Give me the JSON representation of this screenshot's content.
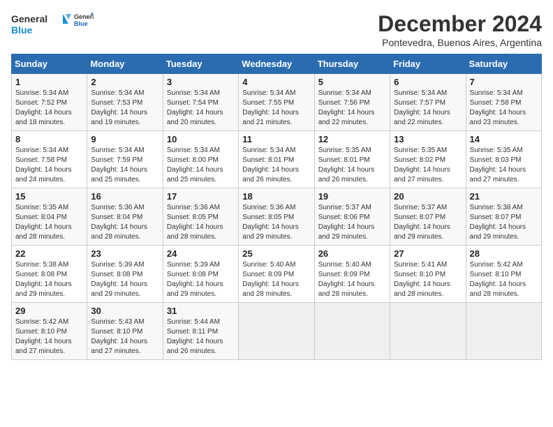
{
  "header": {
    "logo_line1": "General",
    "logo_line2": "Blue",
    "month_year": "December 2024",
    "location": "Pontevedra, Buenos Aires, Argentina"
  },
  "weekdays": [
    "Sunday",
    "Monday",
    "Tuesday",
    "Wednesday",
    "Thursday",
    "Friday",
    "Saturday"
  ],
  "weeks": [
    [
      {
        "day": "1",
        "sunrise": "5:34 AM",
        "sunset": "7:52 PM",
        "daylight": "14 hours and 18 minutes."
      },
      {
        "day": "2",
        "sunrise": "5:34 AM",
        "sunset": "7:53 PM",
        "daylight": "14 hours and 19 minutes."
      },
      {
        "day": "3",
        "sunrise": "5:34 AM",
        "sunset": "7:54 PM",
        "daylight": "14 hours and 20 minutes."
      },
      {
        "day": "4",
        "sunrise": "5:34 AM",
        "sunset": "7:55 PM",
        "daylight": "14 hours and 21 minutes."
      },
      {
        "day": "5",
        "sunrise": "5:34 AM",
        "sunset": "7:56 PM",
        "daylight": "14 hours and 22 minutes."
      },
      {
        "day": "6",
        "sunrise": "5:34 AM",
        "sunset": "7:57 PM",
        "daylight": "14 hours and 22 minutes."
      },
      {
        "day": "7",
        "sunrise": "5:34 AM",
        "sunset": "7:58 PM",
        "daylight": "14 hours and 23 minutes."
      }
    ],
    [
      {
        "day": "8",
        "sunrise": "5:34 AM",
        "sunset": "7:58 PM",
        "daylight": "14 hours and 24 minutes."
      },
      {
        "day": "9",
        "sunrise": "5:34 AM",
        "sunset": "7:59 PM",
        "daylight": "14 hours and 25 minutes."
      },
      {
        "day": "10",
        "sunrise": "5:34 AM",
        "sunset": "8:00 PM",
        "daylight": "14 hours and 25 minutes."
      },
      {
        "day": "11",
        "sunrise": "5:34 AM",
        "sunset": "8:01 PM",
        "daylight": "14 hours and 26 minutes."
      },
      {
        "day": "12",
        "sunrise": "5:35 AM",
        "sunset": "8:01 PM",
        "daylight": "14 hours and 26 minutes."
      },
      {
        "day": "13",
        "sunrise": "5:35 AM",
        "sunset": "8:02 PM",
        "daylight": "14 hours and 27 minutes."
      },
      {
        "day": "14",
        "sunrise": "5:35 AM",
        "sunset": "8:03 PM",
        "daylight": "14 hours and 27 minutes."
      }
    ],
    [
      {
        "day": "15",
        "sunrise": "5:35 AM",
        "sunset": "8:04 PM",
        "daylight": "14 hours and 28 minutes."
      },
      {
        "day": "16",
        "sunrise": "5:36 AM",
        "sunset": "8:04 PM",
        "daylight": "14 hours and 28 minutes."
      },
      {
        "day": "17",
        "sunrise": "5:36 AM",
        "sunset": "8:05 PM",
        "daylight": "14 hours and 28 minutes."
      },
      {
        "day": "18",
        "sunrise": "5:36 AM",
        "sunset": "8:05 PM",
        "daylight": "14 hours and 29 minutes."
      },
      {
        "day": "19",
        "sunrise": "5:37 AM",
        "sunset": "8:06 PM",
        "daylight": "14 hours and 29 minutes."
      },
      {
        "day": "20",
        "sunrise": "5:37 AM",
        "sunset": "8:07 PM",
        "daylight": "14 hours and 29 minutes."
      },
      {
        "day": "21",
        "sunrise": "5:38 AM",
        "sunset": "8:07 PM",
        "daylight": "14 hours and 29 minutes."
      }
    ],
    [
      {
        "day": "22",
        "sunrise": "5:38 AM",
        "sunset": "8:08 PM",
        "daylight": "14 hours and 29 minutes."
      },
      {
        "day": "23",
        "sunrise": "5:39 AM",
        "sunset": "8:08 PM",
        "daylight": "14 hours and 29 minutes."
      },
      {
        "day": "24",
        "sunrise": "5:39 AM",
        "sunset": "8:08 PM",
        "daylight": "14 hours and 29 minutes."
      },
      {
        "day": "25",
        "sunrise": "5:40 AM",
        "sunset": "8:09 PM",
        "daylight": "14 hours and 28 minutes."
      },
      {
        "day": "26",
        "sunrise": "5:40 AM",
        "sunset": "8:09 PM",
        "daylight": "14 hours and 28 minutes."
      },
      {
        "day": "27",
        "sunrise": "5:41 AM",
        "sunset": "8:10 PM",
        "daylight": "14 hours and 28 minutes."
      },
      {
        "day": "28",
        "sunrise": "5:42 AM",
        "sunset": "8:10 PM",
        "daylight": "14 hours and 28 minutes."
      }
    ],
    [
      {
        "day": "29",
        "sunrise": "5:42 AM",
        "sunset": "8:10 PM",
        "daylight": "14 hours and 27 minutes."
      },
      {
        "day": "30",
        "sunrise": "5:43 AM",
        "sunset": "8:10 PM",
        "daylight": "14 hours and 27 minutes."
      },
      {
        "day": "31",
        "sunrise": "5:44 AM",
        "sunset": "8:11 PM",
        "daylight": "14 hours and 26 minutes."
      },
      null,
      null,
      null,
      null
    ]
  ]
}
